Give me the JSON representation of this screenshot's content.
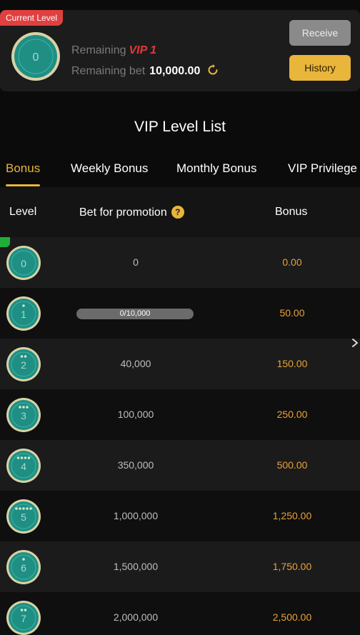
{
  "colors": {
    "accent": "#e9b53a",
    "red": "#e03a3a",
    "badge_green": "#1f8f84"
  },
  "current": {
    "tag": "Current Level",
    "badge_icon": "vip-0-badge-icon",
    "level_number": "0",
    "remaining_label": "Remaining",
    "remaining_vip": "VIP 1",
    "remaining_bet_label": "Remaining bet",
    "remaining_bet_value": "10,000.00"
  },
  "buttons": {
    "receive": "Receive",
    "history": "History"
  },
  "list_title": "VIP Level List",
  "tabs": [
    {
      "label": "Bonus",
      "active": true
    },
    {
      "label": "Weekly Bonus",
      "active": false
    },
    {
      "label": "Monthly Bonus",
      "active": false
    },
    {
      "label": "VIP Privilege",
      "active": false
    }
  ],
  "table": {
    "headers": {
      "level": "Level",
      "bet": "Bet for promotion",
      "bonus": "Bonus",
      "help": "?"
    },
    "rows": [
      {
        "level": "0",
        "bet": "0",
        "bonus": "0.00",
        "stars": 0,
        "current": true
      },
      {
        "level": "1",
        "bet": "0/10,000",
        "bonus": "50.00",
        "stars": 1,
        "progress": 0.0
      },
      {
        "level": "2",
        "bet": "40,000",
        "bonus": "150.00",
        "stars": 2
      },
      {
        "level": "3",
        "bet": "100,000",
        "bonus": "250.00",
        "stars": 3
      },
      {
        "level": "4",
        "bet": "350,000",
        "bonus": "500.00",
        "stars": 4
      },
      {
        "level": "5",
        "bet": "1,000,000",
        "bonus": "1,250.00",
        "stars": 5
      },
      {
        "level": "6",
        "bet": "1,500,000",
        "bonus": "1,750.00",
        "stars": 1
      },
      {
        "level": "7",
        "bet": "2,000,000",
        "bonus": "2,500.00",
        "stars": 2
      }
    ]
  }
}
